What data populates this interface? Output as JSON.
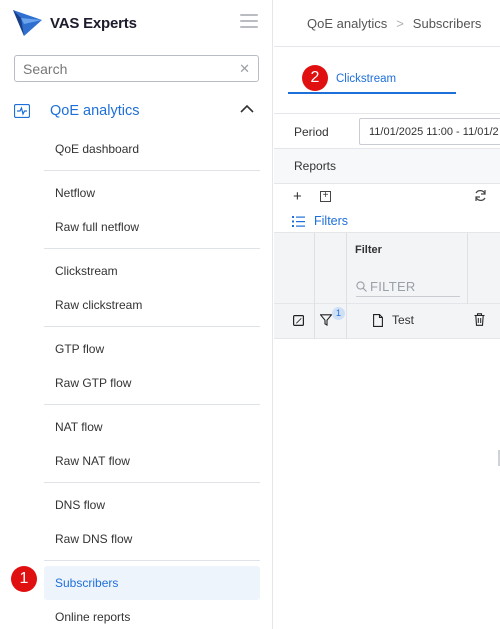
{
  "brand": {
    "name": "VAS Experts",
    "accent": "#1e6fd9"
  },
  "search": {
    "placeholder": "Search",
    "clear_icon": "close-icon"
  },
  "sidebar": {
    "section": {
      "label": "QoE analytics",
      "icon": "analytics-icon",
      "expanded_icon": "chevron-up-icon"
    },
    "items": [
      {
        "label": "QoE dashboard"
      },
      {
        "label": "Netflow"
      },
      {
        "label": "Raw full netflow"
      },
      {
        "label": "Clickstream"
      },
      {
        "label": "Raw clickstream"
      },
      {
        "label": "GTP flow"
      },
      {
        "label": "Raw GTP flow"
      },
      {
        "label": "NAT flow"
      },
      {
        "label": "Raw NAT flow"
      },
      {
        "label": "DNS flow"
      },
      {
        "label": "Raw DNS flow"
      },
      {
        "label": "Subscribers",
        "active": true
      },
      {
        "label": "Online reports"
      }
    ]
  },
  "breadcrumb": {
    "items": [
      "QoE analytics",
      "Subscribers"
    ],
    "separator": ">"
  },
  "tabs": [
    {
      "label": "Clickstream",
      "active": true
    }
  ],
  "period": {
    "label": "Period",
    "value": "11/01/2025 11:00 - 11/01/2"
  },
  "reports": {
    "label": "Reports"
  },
  "filters": {
    "label": "Filters"
  },
  "grid": {
    "filter_header": "Filter",
    "filter_placeholder": "FILTER",
    "rows": [
      {
        "name": "Test",
        "filter_count": "1"
      }
    ]
  },
  "annotations": {
    "badge1": "1",
    "badge2": "2",
    "badge_color": "#e11010"
  }
}
